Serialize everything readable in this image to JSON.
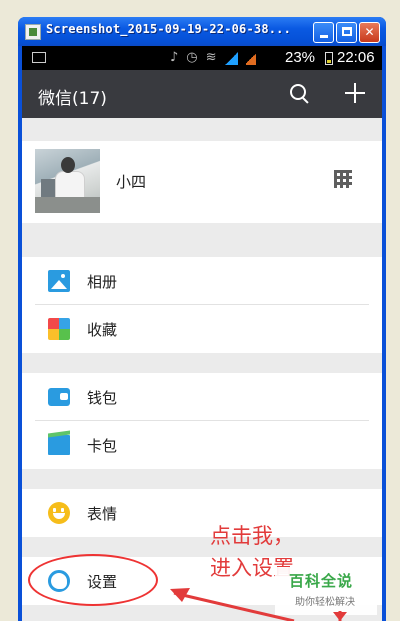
{
  "window": {
    "title": "Screenshot_2015-09-19-22-06-38..."
  },
  "statusbar": {
    "battery": "23%",
    "time": "22:06"
  },
  "appbar": {
    "title": "微信(17)",
    "search_icon": "search-icon",
    "add_icon": "plus-icon"
  },
  "profile": {
    "name": "小四"
  },
  "menu": {
    "album": "相册",
    "favorites": "收藏",
    "wallet": "钱包",
    "cards": "卡包",
    "stickers": "表情",
    "settings": "设置"
  },
  "annotation": {
    "line1": "点击我，",
    "line2": "进入设置"
  },
  "watermark": {
    "title": "百科全说",
    "subtitle": "助你轻松解决"
  },
  "colors": {
    "appbar": "#393a3f",
    "accent_blue": "#2a9be0",
    "annotation_red": "#e23b3b",
    "watermark_green": "#3aa84a"
  }
}
